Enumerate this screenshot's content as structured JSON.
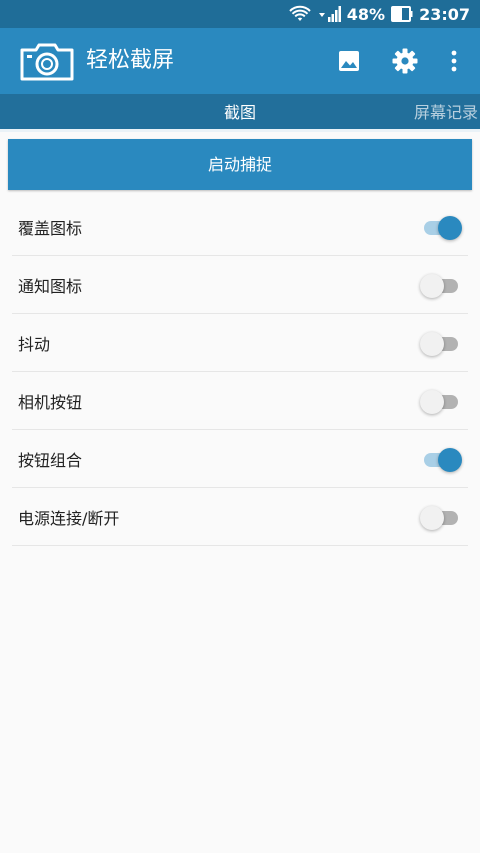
{
  "status_bar": {
    "battery_percent": "48%",
    "time": "23:07",
    "icons": [
      "wifi-icon",
      "signal-icon",
      "battery-icon"
    ]
  },
  "app_bar": {
    "title": "轻松截屏",
    "logo_icon": "camera-icon",
    "actions": [
      "gallery-icon",
      "settings-icon",
      "more-vert-icon"
    ]
  },
  "tabs": [
    {
      "label": "截图",
      "selected": true
    },
    {
      "label": "屏幕记录",
      "selected": false
    }
  ],
  "start_button": {
    "label": "启动捕捉"
  },
  "settings": [
    {
      "label": "覆盖图标",
      "on": true
    },
    {
      "label": "通知图标",
      "on": false
    },
    {
      "label": "抖动",
      "on": false
    },
    {
      "label": "相机按钮",
      "on": false
    },
    {
      "label": "按钮组合",
      "on": true
    },
    {
      "label": "电源连接/断开",
      "on": false
    }
  ],
  "colors": {
    "status_bar": "#1f6d98",
    "app_bar": "#2a89bf",
    "tab_bar": "#226f9b",
    "toggle_on": "#2a89bf",
    "toggle_on_track": "#a9cfe6",
    "toggle_off_track": "#b2b2b2"
  }
}
